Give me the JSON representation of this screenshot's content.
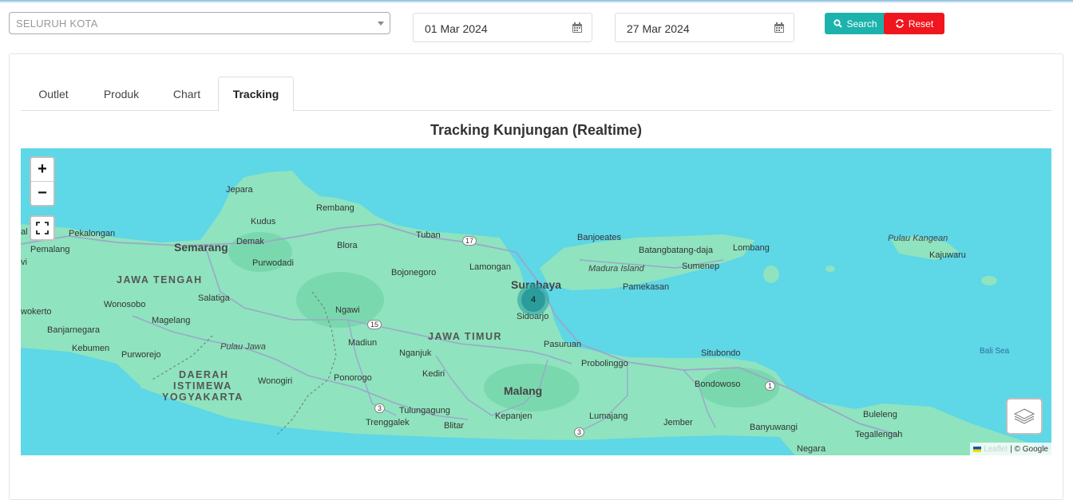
{
  "filters": {
    "city_select_value": "SELURUH KOTA",
    "date_from": "01 Mar 2024",
    "date_to": "27 Mar 2024",
    "search_label": "Search",
    "reset_label": "Reset"
  },
  "tabs": [
    {
      "label": "Outlet",
      "active": false
    },
    {
      "label": "Produk",
      "active": false
    },
    {
      "label": "Chart",
      "active": false
    },
    {
      "label": "Tracking",
      "active": true
    }
  ],
  "map": {
    "title": "Tracking Kunjungan (Realtime)",
    "zoom_in": "+",
    "zoom_out": "−",
    "cluster_count": "4",
    "attribution_leaflet": "Leaflet",
    "attribution_google": "| © Google",
    "labels": {
      "jepara": "Jepara",
      "rembang": "Rembang",
      "kudus": "Kudus",
      "tuban": "Tuban",
      "pekalongan": "Pekalongan",
      "semarang": "Semarang",
      "demak": "Demak",
      "pemalang": "Pemalang",
      "blora": "Blora",
      "purwodadi": "Purwodadi",
      "bojonegoro": "Bojonegoro",
      "lamongan": "Lamongan",
      "jawa_tengah": "JAWA TENGAH",
      "wonosobo": "Wonosobo",
      "salatiga": "Salatiga",
      "ngawi": "Ngawi",
      "magelang": "Magelang",
      "banjarnegara": "Banjarnegara",
      "purwokerto": "wokerto",
      "kebumen": "Kebumen",
      "purworejo": "Purworejo",
      "pulau_jawa": "Pulau Jawa",
      "madiun": "Madiun",
      "nganjuk": "Nganjuk",
      "jawa_timur": "JAWA TIMUR",
      "diy_1": "DAERAH",
      "diy_2": "ISTIMEWA",
      "diy_3": "YOGYAKARTA",
      "wonogiri": "Wonogiri",
      "ponorogo": "Ponorogo",
      "kediri": "Kediri",
      "malang": "Malang",
      "tulungagung": "Tulungagung",
      "trenggalek": "Trenggalek",
      "blitar": "Blitar",
      "kepanjen": "Kepanjen",
      "lumajang": "Lumajang",
      "jember": "Jember",
      "surabaya": "Surabaya",
      "sidoarjo": "Sidoarjo",
      "pasuruan": "Pasuruan",
      "probolinggo": "Probolinggo",
      "situbondo": "Situbondo",
      "bondowoso": "Bondowoso",
      "banyuwangi": "Banyuwangi",
      "banjoeates": "Banjoeates",
      "batangbatang": "Batangbatang-daja",
      "lombang": "Lombang",
      "madura_island": "Madura Island",
      "sumenep": "Sumenep",
      "pamekasan": "Pamekasan",
      "pulau_kangean": "Pulau Kangean",
      "kajuwaru": "Kajuwaru",
      "bali_sea": "Bali Sea",
      "buleleng": "Buleleng",
      "tegallengah": "Tegallengah",
      "negara": "Negara",
      "road_17": "17",
      "road_15": "15",
      "road_3a": "3",
      "road_3b": "3",
      "road_1": "1",
      "edge_al": "al",
      "edge_vi": "vi"
    }
  },
  "colors": {
    "search_button": "#1cb3ac",
    "reset_button": "#f0161e",
    "sea": "#5ed7e6",
    "land": "#8fe3bf",
    "cluster": "#2a9c9c"
  }
}
